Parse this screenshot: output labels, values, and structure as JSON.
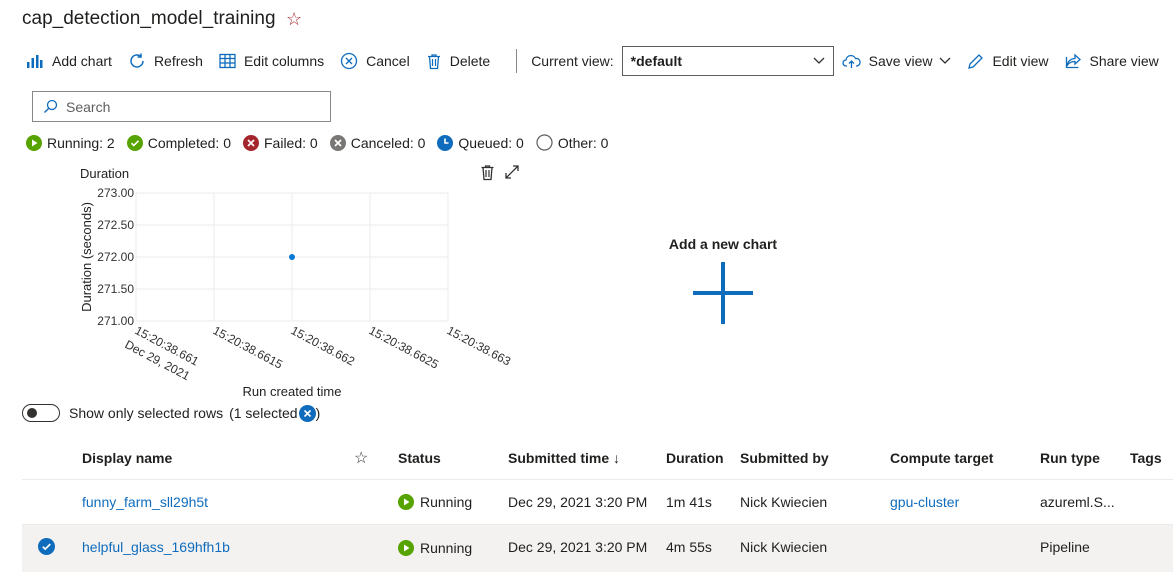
{
  "page": {
    "title": "cap_detection_model_training"
  },
  "toolbar": {
    "add_chart": "Add chart",
    "refresh": "Refresh",
    "edit_columns": "Edit columns",
    "cancel": "Cancel",
    "delete": "Delete",
    "current_view_label": "Current view:",
    "current_view_value": "*default",
    "save_view": "Save view",
    "edit_view": "Edit view",
    "share_view": "Share view"
  },
  "search": {
    "placeholder": "Search"
  },
  "status_filters": [
    {
      "label": "Running: 2",
      "color": "#57a300"
    },
    {
      "label": "Completed: 0",
      "color": "#57a300"
    },
    {
      "label": "Failed: 0",
      "color": "#a4262c"
    },
    {
      "label": "Canceled: 0",
      "color": "#797775"
    },
    {
      "label": "Queued: 0",
      "color": "#0f6cbd"
    },
    {
      "label": "Other: 0",
      "color": "#605e5c"
    }
  ],
  "chart_data": {
    "type": "scatter",
    "title": "Duration",
    "xlabel": "Run created time",
    "ylabel": "Duration (seconds)",
    "ylim": [
      271,
      273
    ],
    "y_ticks": [
      "273.00",
      "272.50",
      "272.00",
      "271.50",
      "271.00"
    ],
    "x_ticks": [
      "15:20:38.661",
      "15:20:38.6615",
      "15:20:38.662",
      "15:20:38.6625",
      "15:20:38.663"
    ],
    "x_date_label": "Dec 29, 2021",
    "grid": true,
    "series": [
      {
        "points": [
          {
            "x": "15:20:38.662",
            "y": 272.0
          }
        ],
        "color": "#0078d4"
      }
    ]
  },
  "add_chart_panel": {
    "label": "Add a new chart"
  },
  "selection": {
    "toggle_label": "Show only selected rows",
    "selected_text": "(1 selected",
    "close_paren": ")"
  },
  "table": {
    "headers": {
      "display_name": "Display name",
      "status": "Status",
      "submitted_time": "Submitted time ↓",
      "duration": "Duration",
      "submitted_by": "Submitted by",
      "compute_target": "Compute target",
      "run_type": "Run type",
      "tags": "Tags"
    },
    "rows": [
      {
        "display_name": "funny_farm_sll29h5t",
        "status": "Running",
        "submitted_time": "Dec 29, 2021 3:20 PM",
        "duration": "1m 41s",
        "submitted_by": "Nick Kwiecien",
        "compute_target": "gpu-cluster",
        "run_type": "azureml.S..."
      },
      {
        "display_name": "helpful_glass_169hfh1b",
        "status": "Running",
        "submitted_time": "Dec 29, 2021 3:20 PM",
        "duration": "4m 55s",
        "submitted_by": "Nick Kwiecien",
        "compute_target": "",
        "run_type": "Pipeline"
      }
    ]
  }
}
